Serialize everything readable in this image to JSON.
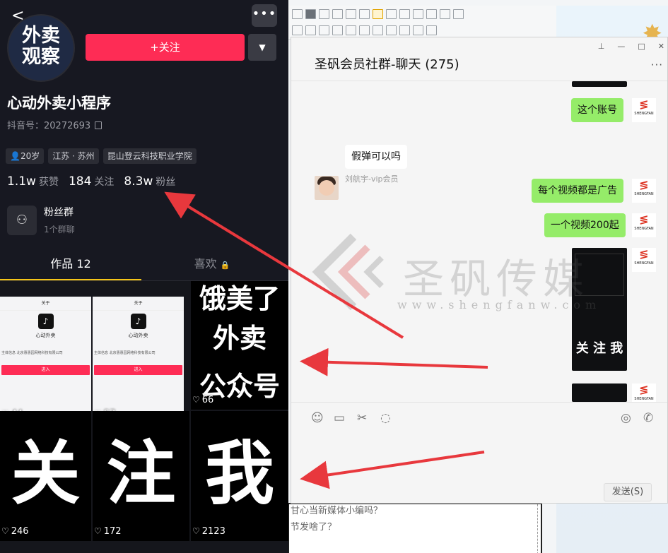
{
  "douyin": {
    "follow_label": "+关注",
    "account_name": "心动外卖小程序",
    "douyin_id": "抖音号：20272693",
    "avatar_line1": "外卖",
    "avatar_line2": "观察",
    "tags": [
      "20岁",
      "江苏 · 苏州",
      "昆山登云科技职业学院"
    ],
    "stats": [
      {
        "value": "1.1w",
        "label": "获赞"
      },
      {
        "value": "184",
        "label": "关注"
      },
      {
        "value": "8.3w",
        "label": "粉丝"
      }
    ],
    "fans_group": {
      "name": "粉丝群",
      "sub": "1个群聊"
    },
    "tabs": {
      "works": "作品 12",
      "likes": "喜欢"
    },
    "videos": [
      {
        "likes": "44"
      },
      {
        "likes": "57"
      },
      {
        "likes": "66",
        "lines": [
          "饿美了",
          "外卖",
          "公众号"
        ]
      },
      {
        "likes": "246",
        "char": "关"
      },
      {
        "likes": "172",
        "char": "注"
      },
      {
        "likes": "2123",
        "char": "我"
      }
    ],
    "mini": {
      "header": "关于",
      "app_name": "心动外卖",
      "enter": "进入",
      "row_left": "主体信息",
      "row_right": "北京惠惠园网络科技有限公司"
    }
  },
  "wechat": {
    "title": "圣矾会员社群-聊天 (275)",
    "messages": {
      "m1": "这个账号",
      "sender": "刘航宇-vip会员",
      "m2": "假弹可以吗",
      "m3": "每个视频都是广告",
      "m4": "一个视频200起"
    },
    "thumb_text": [
      "关",
      "注",
      "我"
    ],
    "send_label": "发送(S)",
    "avatar_label": "SHENGFAN"
  },
  "doc": {
    "line1": "甘心当新媒体小编吗？",
    "line2": "节发啥了？"
  },
  "watermark": {
    "cn": "圣矾传媒",
    "url": "www.shengfanw.com"
  },
  "colors": {
    "follow": "#fe2c55",
    "bubble_me": "#95ec69",
    "arrow": "#e8383d"
  }
}
